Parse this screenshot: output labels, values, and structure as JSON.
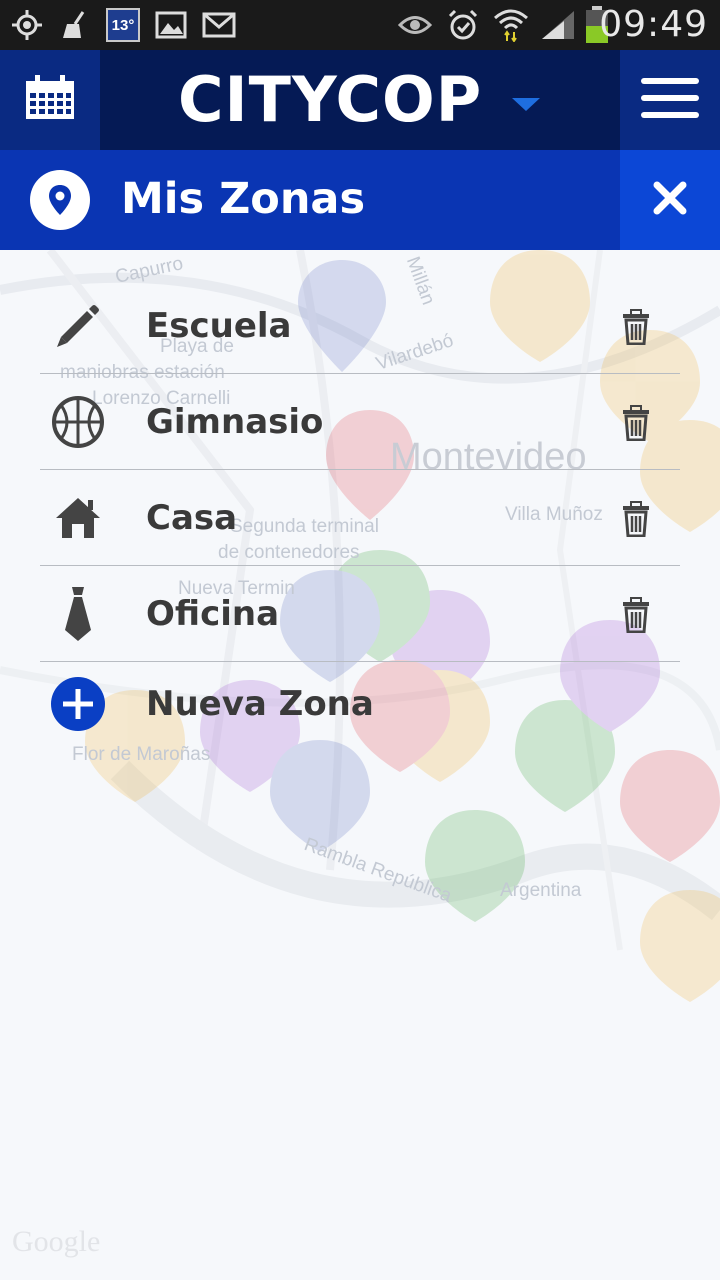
{
  "status_bar": {
    "temperature": "13°",
    "time": "09:49"
  },
  "app_bar": {
    "logo": "CITYCOP"
  },
  "section": {
    "title": "Mis Zonas"
  },
  "map": {
    "labels": [
      "Capurro",
      "Playa de",
      "maniobras estación",
      "Lorenzo Carnelli",
      "Montevideo",
      "Villa Muñoz",
      "Segunda terminal",
      "de contenedores",
      "Nueva Termin",
      "Vilardebó",
      "Rambla República",
      "Argentina",
      "Flor de Maroñas",
      "Millán",
      "Google"
    ]
  },
  "zones": [
    {
      "label": "Escuela",
      "icon": "pencil-icon"
    },
    {
      "label": "Gimnasio",
      "icon": "basketball-icon"
    },
    {
      "label": "Casa",
      "icon": "house-icon"
    },
    {
      "label": "Oficina",
      "icon": "tie-icon"
    }
  ],
  "new_zone": {
    "label": "Nueva Zona",
    "icon": "add-circle-icon"
  },
  "colors": {
    "app_bar": "#051a55",
    "app_bar_button": "#0a2a82",
    "section_header": "#0a35b3",
    "close_button": "#0c47d6",
    "accent": "#1e6ee0"
  }
}
